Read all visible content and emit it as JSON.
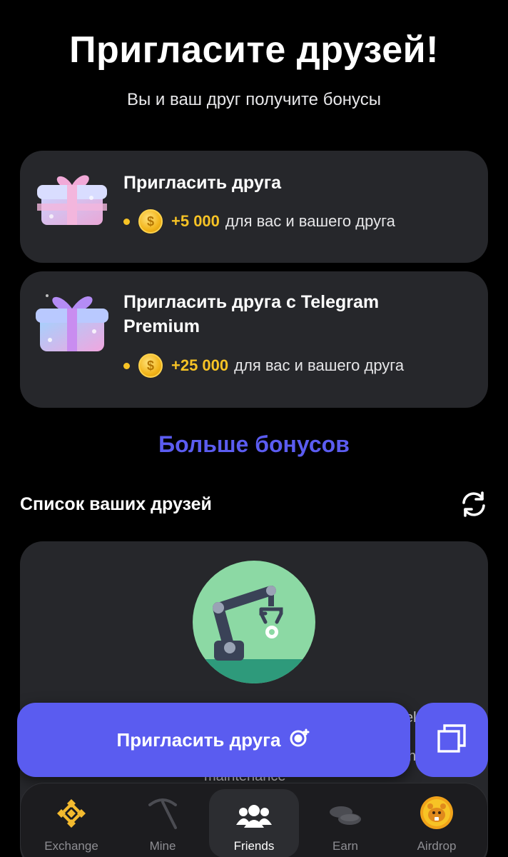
{
  "header": {
    "title": "Пригласите друзей!",
    "subtitle": "Вы и ваш друг получите бонусы"
  },
  "invite_cards": [
    {
      "title": "Пригласить друга",
      "amount": "+5 000",
      "reward_text": "для вас и вашего друга",
      "icon": "gift-icon"
    },
    {
      "title": "Пригласить друга с Telegram Premium",
      "amount": "+25 000",
      "reward_text": "для вас и вашего друга",
      "icon": "gift-premium-icon"
    }
  ],
  "more_bonuses_label": "Больше бонусов",
  "friends_list": {
    "title": "Список ваших друзей",
    "refresh_icon": "refresh-icon",
    "illustration_icon": "robot-arm-icon",
    "partial_text": "maintenance",
    "peek_char_1": "el",
    "peek_char_2": "h"
  },
  "invite_button": {
    "label": "Пригласить друга",
    "icon": "add-user-icon"
  },
  "copy_button": {
    "icon": "copy-icon"
  },
  "colors": {
    "accent": "#5a5cf0",
    "coin": "#f7c325",
    "card_bg": "#26272b"
  },
  "nav": {
    "items": [
      {
        "label": "Exchange",
        "icon": "binance-icon",
        "active": false
      },
      {
        "label": "Mine",
        "icon": "pickaxe-icon",
        "active": false
      },
      {
        "label": "Friends",
        "icon": "friends-icon",
        "active": true
      },
      {
        "label": "Earn",
        "icon": "coins-icon",
        "active": false
      },
      {
        "label": "Airdrop",
        "icon": "hamster-coin-icon",
        "active": false
      }
    ]
  }
}
